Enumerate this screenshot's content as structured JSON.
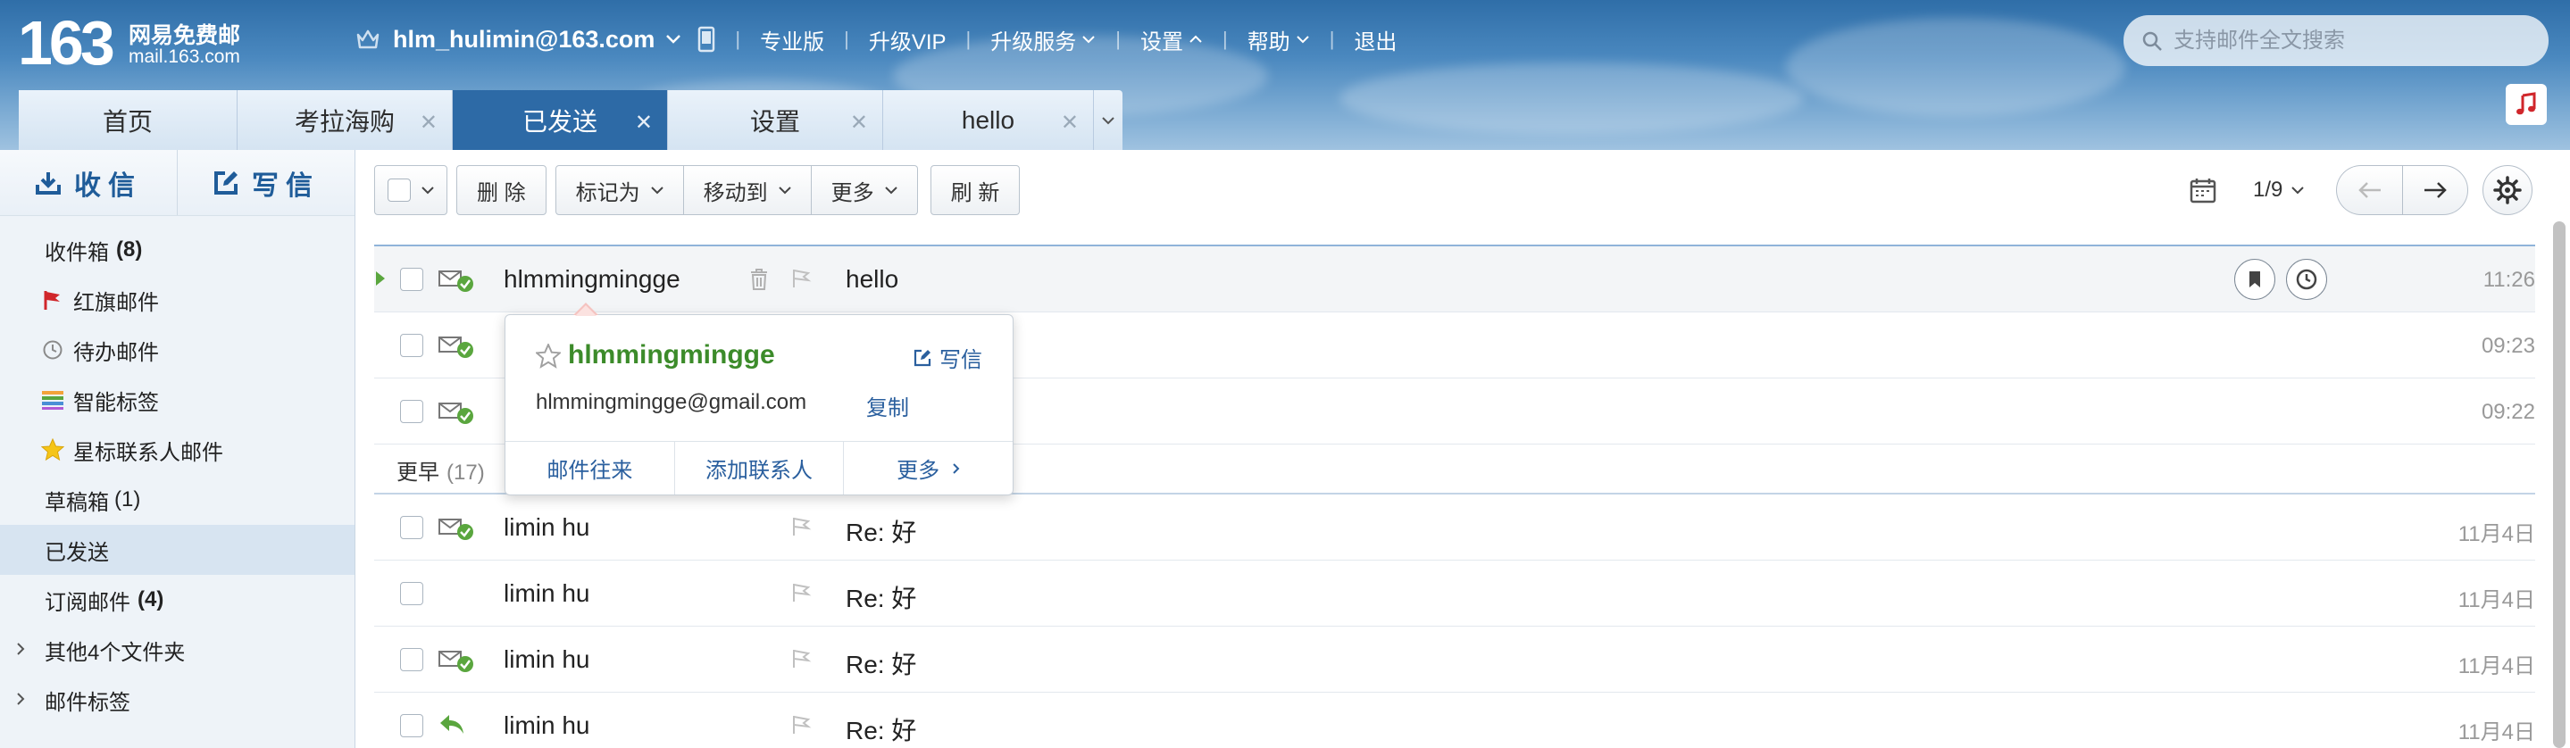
{
  "brand": {
    "logo_number": "163",
    "logo_name": "网易免费邮",
    "logo_domain": "mail.163.com"
  },
  "header": {
    "account": "hlm_hulimin@163.com",
    "nav": [
      "专业版",
      "升级VIP",
      "升级服务",
      "设置",
      "帮助",
      "退出"
    ],
    "search_placeholder": "支持邮件全文搜索"
  },
  "tabs": [
    {
      "label": "首页",
      "closable": false,
      "active": false
    },
    {
      "label": "考拉海购",
      "closable": true,
      "active": false
    },
    {
      "label": "已发送",
      "closable": true,
      "active": true
    },
    {
      "label": "设置",
      "closable": true,
      "active": false
    },
    {
      "label": "hello",
      "closable": true,
      "active": false
    }
  ],
  "sidebar": {
    "receive_label": "收信",
    "compose_label": "写信",
    "folders": {
      "inbox": {
        "label": "收件箱",
        "count": "(8)"
      },
      "flagged": {
        "label": "红旗邮件"
      },
      "todo": {
        "label": "待办邮件"
      },
      "smart": {
        "label": "智能标签"
      },
      "starred": {
        "label": "星标联系人邮件"
      },
      "drafts": {
        "label": "草稿箱",
        "count": "(1)"
      },
      "sent": {
        "label": "已发送"
      },
      "subscribe": {
        "label": "订阅邮件",
        "count": "(4)"
      },
      "other": {
        "label": "其他4个文件夹"
      },
      "tags": {
        "label": "邮件标签"
      }
    }
  },
  "toolbar": {
    "delete": "删 除",
    "mark_as": "标记为",
    "move_to": "移动到",
    "more": "更多",
    "refresh": "刷 新",
    "pager": "1/9"
  },
  "emails_today": [
    {
      "from": "hlmmingmingge",
      "subject": "hello",
      "time": "11:26"
    },
    {
      "from": "",
      "subject": "",
      "time": "09:23"
    },
    {
      "from": "",
      "subject": "",
      "time": "09:22"
    }
  ],
  "group": {
    "label": "更早",
    "count": "(17)"
  },
  "emails_earlier": [
    {
      "from": "limin hu",
      "subject": "Re: 好",
      "time": "11月4日"
    },
    {
      "from": "limin hu",
      "subject": "Re: 好",
      "time": "11月4日"
    },
    {
      "from": "limin hu",
      "subject": "Re: 好",
      "time": "11月4日"
    },
    {
      "from": "limin hu",
      "subject": "Re: 好",
      "time": "11月4日"
    }
  ],
  "contact_card": {
    "name": "hlmmingmingge",
    "write_label": "写信",
    "email": "hlmmingmingge@gmail.com",
    "copy_label": "复制",
    "actions": [
      "邮件往来",
      "添加联系人",
      "更多"
    ]
  },
  "colors": {
    "accent": "#2d6aa6",
    "contact_name": "#3c8b2a",
    "flag": "#d0262b",
    "sent_check": "#5aa63e"
  }
}
